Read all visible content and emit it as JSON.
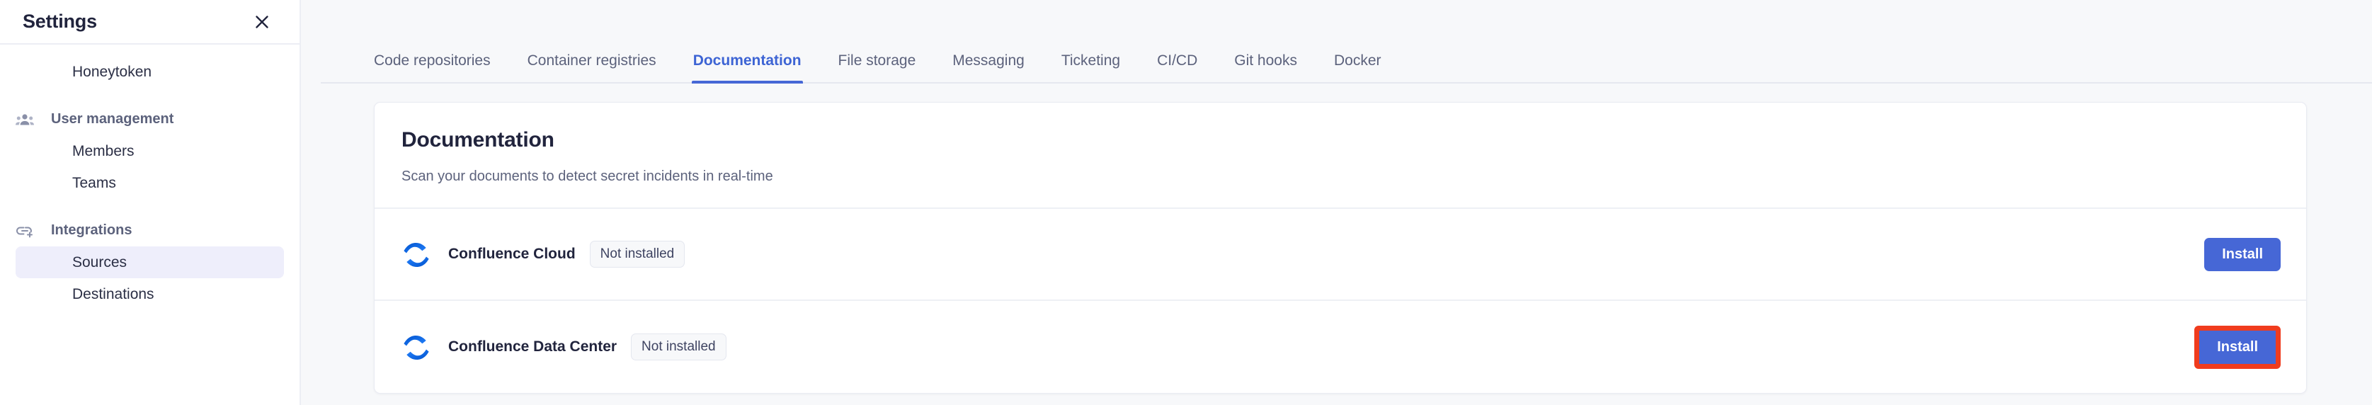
{
  "sidebar": {
    "title": "Settings",
    "close_icon": "close-icon",
    "items": [
      {
        "label": "Honeytoken",
        "type": "item",
        "selected": false,
        "icon": null
      },
      {
        "label": "User management",
        "type": "group",
        "selected": false,
        "icon": "users-group-icon"
      },
      {
        "label": "Members",
        "type": "item",
        "selected": false,
        "icon": null
      },
      {
        "label": "Teams",
        "type": "item",
        "selected": false,
        "icon": null
      },
      {
        "label": "Integrations",
        "type": "group",
        "selected": false,
        "icon": "link-plus-icon"
      },
      {
        "label": "Sources",
        "type": "item",
        "selected": true,
        "icon": null
      },
      {
        "label": "Destinations",
        "type": "item",
        "selected": false,
        "icon": null
      }
    ]
  },
  "tabs": [
    {
      "label": "Code repositories",
      "active": false
    },
    {
      "label": "Container registries",
      "active": false
    },
    {
      "label": "Documentation",
      "active": true
    },
    {
      "label": "File storage",
      "active": false
    },
    {
      "label": "Messaging",
      "active": false
    },
    {
      "label": "Ticketing",
      "active": false
    },
    {
      "label": "CI/CD",
      "active": false
    },
    {
      "label": "Git hooks",
      "active": false
    },
    {
      "label": "Docker",
      "active": false
    }
  ],
  "card": {
    "title": "Documentation",
    "subtitle": "Scan your documents to detect secret incidents in real-time",
    "rows": [
      {
        "name": "Confluence Cloud",
        "logo_icon": "confluence-logo-icon",
        "status": "Not installed",
        "action_label": "Install",
        "highlighted": false
      },
      {
        "name": "Confluence Data Center",
        "logo_icon": "confluence-logo-icon",
        "status": "Not installed",
        "action_label": "Install",
        "highlighted": true
      }
    ]
  },
  "colors": {
    "accent": "#4667d6",
    "active_tab": "#3d64d4",
    "highlight": "#f03c1e",
    "page_bg": "#f7f8fa",
    "sidebar_selected": "#eeeefb",
    "confluence_blue_dark": "#1668dd",
    "confluence_blue_light": "#2684ff"
  }
}
